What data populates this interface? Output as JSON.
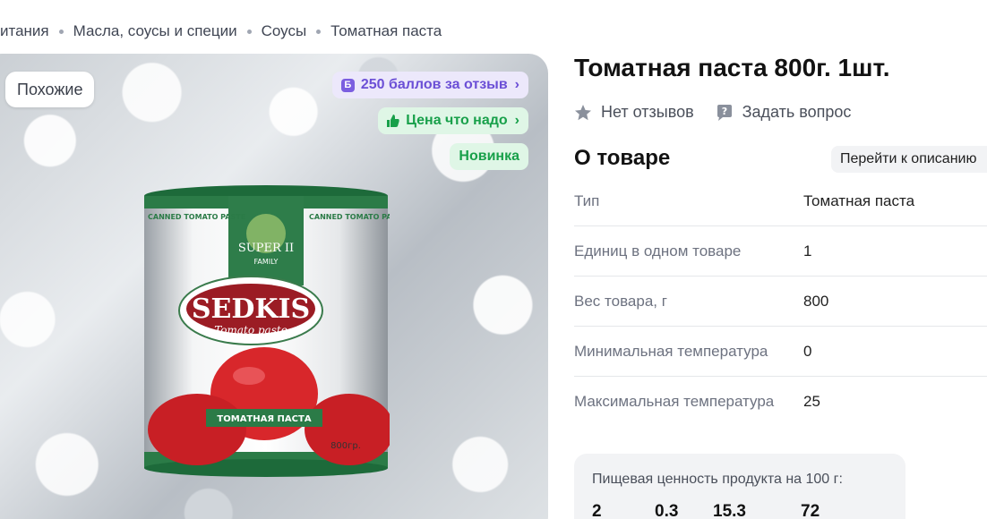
{
  "breadcrumb": [
    "итания",
    "Масла, соусы и специи",
    "Соусы",
    "Томатная паста"
  ],
  "gallery": {
    "similar_label": "Похожие",
    "badges": {
      "points_icon": "Б",
      "points": "250 баллов за отзыв",
      "price": "Цена что надо",
      "new": "Новинка"
    },
    "can_brand": "SEDKIS",
    "can_sub": "Tomato paste",
    "can_label_left": "CANNED TOMATO PASTE",
    "can_label_right": "CANNED TOMATO PASTE",
    "can_top": "SUPER II",
    "can_family": "FAMILY",
    "can_ribbon": "ТОМАТНАЯ ПАСТА",
    "can_weight": "800гр."
  },
  "product": {
    "title": "Томатная паста 800г. 1шт.",
    "reviews": "Нет отзывов",
    "ask": "Задать вопрос"
  },
  "about": {
    "title": "О товаре",
    "goto": "Перейти к описанию",
    "specs": [
      {
        "key": "Тип",
        "value": "Томатная паста"
      },
      {
        "key": "Единиц в одном товаре",
        "value": "1"
      },
      {
        "key": "Вес товара, г",
        "value": "800"
      },
      {
        "key": "Минимальная температура",
        "value": "0"
      },
      {
        "key": "Максимальная температура",
        "value": "25"
      }
    ]
  },
  "nutrition": {
    "title": "Пищевая ценность продукта на 100 г:",
    "values": [
      "2",
      "0.3",
      "15.3",
      "72"
    ]
  },
  "colors": {
    "accent_purple": "#6b4fd6",
    "accent_green": "#18a04a"
  }
}
